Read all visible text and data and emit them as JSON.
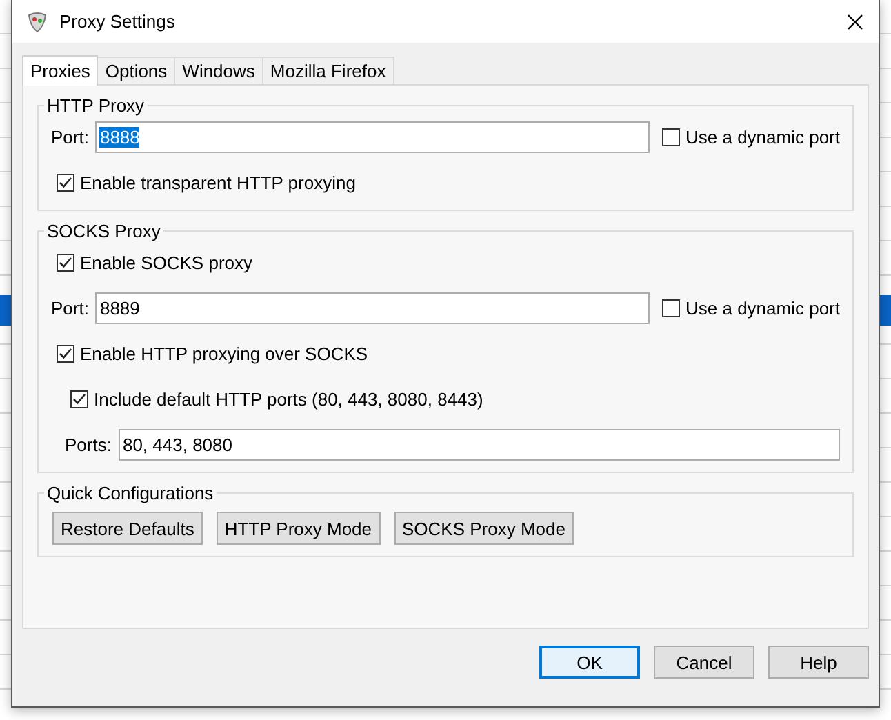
{
  "window": {
    "title": "Proxy Settings"
  },
  "tabs": [
    {
      "label": "Proxies",
      "selected": true
    },
    {
      "label": "Options",
      "selected": false
    },
    {
      "label": "Windows",
      "selected": false
    },
    {
      "label": "Mozilla Firefox",
      "selected": false
    }
  ],
  "http_proxy": {
    "title": "HTTP Proxy",
    "port_label": "Port:",
    "port_value": "8888",
    "port_value_selected": true,
    "dynamic_port": {
      "label": "Use a dynamic port",
      "checked": false
    },
    "transparent": {
      "label": "Enable transparent HTTP proxying",
      "checked": true
    }
  },
  "socks_proxy": {
    "title": "SOCKS Proxy",
    "enable": {
      "label": "Enable SOCKS proxy",
      "checked": true
    },
    "port_label": "Port:",
    "port_value": "8889",
    "dynamic_port": {
      "label": "Use a dynamic port",
      "checked": false
    },
    "http_over_socks": {
      "label": "Enable HTTP proxying over SOCKS",
      "checked": true
    },
    "include_default_ports": {
      "label": "Include default HTTP ports (80, 443, 8080, 8443)",
      "checked": true
    },
    "ports_label": "Ports:",
    "ports_value": "80, 443, 8080"
  },
  "quick_configurations": {
    "title": "Quick Configurations",
    "buttons": [
      "Restore Defaults",
      "HTTP Proxy Mode",
      "SOCKS Proxy Mode"
    ]
  },
  "buttons": [
    {
      "label": "OK",
      "default": true
    },
    {
      "label": "Cancel",
      "default": false
    },
    {
      "label": "Help",
      "default": false
    }
  ]
}
